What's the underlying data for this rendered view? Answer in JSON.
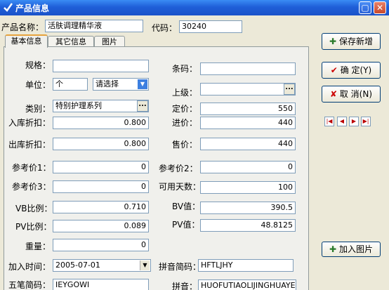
{
  "window": {
    "title": "产品信息",
    "minimize": "▢",
    "close": "✕"
  },
  "header": {
    "name_label": "产品名称：",
    "name_value": "活肤调理精华液",
    "code_label": "代码：",
    "code_value": "30240"
  },
  "tabs": [
    "基本信息",
    "其它信息",
    "图片"
  ],
  "form": {
    "spec_label": "规格：",
    "spec_value": "",
    "barcode_label": "条码：",
    "barcode_value": "",
    "unit_label": "单位：",
    "unit_value": "个",
    "unit_select": "请选择",
    "parent_label": "上级：",
    "parent_value": "",
    "category_label": "类别：",
    "category_value": "特别护理系列",
    "price_label": "定价：",
    "price_value": "550",
    "in_discount_label": "入库折扣：",
    "in_discount_value": "0.800",
    "cost_label": "进价：",
    "cost_value": "440",
    "out_discount_label": "出库折扣：",
    "out_discount_value": "0.800",
    "sale_label": "售价：",
    "sale_value": "440",
    "ref1_label": "参考价1：",
    "ref1_value": "0",
    "ref2_label": "参考价2：",
    "ref2_value": "0",
    "ref3_label": "参考价3：",
    "ref3_value": "0",
    "days_label": "可用天数：",
    "days_value": "100",
    "vb_label": "VB比例：",
    "vb_value": "0.710",
    "bv_label": "BV值：",
    "bv_value": "390.5",
    "pv_ratio_label": "PV比例：",
    "pv_ratio_value": "0.089",
    "pv_label": "PV值：",
    "pv_value": "48.8125",
    "weight_label": "重量：",
    "weight_value": "0",
    "date_label": "加入时间：",
    "date_value": "2005-07-01",
    "pinyin_short_label": "拼音简码：",
    "pinyin_short_value": "HFTLJHY",
    "wubi_label": "五笔简码：",
    "wubi_value": "IEYGOWI",
    "pinyin_label": "拼音：",
    "pinyin_value": "HUOFUTIAOLIJINGHUAYE"
  },
  "buttons": {
    "save_new": "保存新增",
    "ok": "确 定(Y)",
    "cancel": "取 消(N)",
    "add_image": "加入图片",
    "ellipsis": "...",
    "dropdown": "▼"
  },
  "nav": [
    "|◀",
    "◀",
    "▶",
    "▶|"
  ],
  "colors": {
    "title_bar": "#1f5fd8",
    "ok_check": "#cc0000",
    "cancel_x": "#cc0000",
    "plus_icon": "#2a7a2a"
  }
}
